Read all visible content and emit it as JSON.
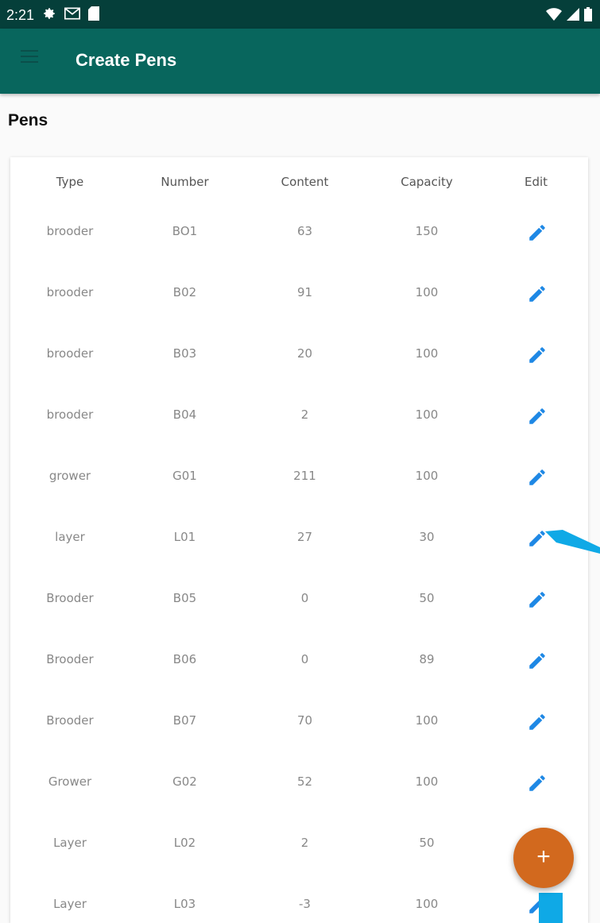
{
  "status_bar": {
    "time": "2:21"
  },
  "app_bar": {
    "title": "Create Pens"
  },
  "section": {
    "title": "Pens"
  },
  "table": {
    "headers": [
      "Type",
      "Number",
      "Content",
      "Capacity",
      "Edit"
    ],
    "rows": [
      [
        "brooder",
        "BO1",
        "63",
        "150"
      ],
      [
        "brooder",
        "B02",
        "91",
        "100"
      ],
      [
        "brooder",
        "B03",
        "20",
        "100"
      ],
      [
        "brooder",
        "B04",
        "2",
        "100"
      ],
      [
        "grower",
        "G01",
        "211",
        "100"
      ],
      [
        "layer",
        "L01",
        "27",
        "30"
      ],
      [
        "Brooder",
        "B05",
        "0",
        "50"
      ],
      [
        "Brooder",
        "B06",
        "0",
        "89"
      ],
      [
        "Brooder",
        "B07",
        "70",
        "100"
      ],
      [
        "Grower",
        "G02",
        "52",
        "100"
      ],
      [
        "Layer",
        "L02",
        "2",
        "50"
      ],
      [
        "Layer",
        "L03",
        "-3",
        "100"
      ]
    ]
  },
  "fab": {
    "label": "+"
  },
  "icons": {
    "edit": "pencil-icon",
    "menu": "hamburger-menu-icon",
    "add": "plus-icon"
  },
  "colors": {
    "app_bar": "#08665d",
    "status_bar": "#053f3a",
    "edit_icon": "#1e88e5",
    "fab": "#d2691e",
    "annotation": "#0fa9e6"
  }
}
